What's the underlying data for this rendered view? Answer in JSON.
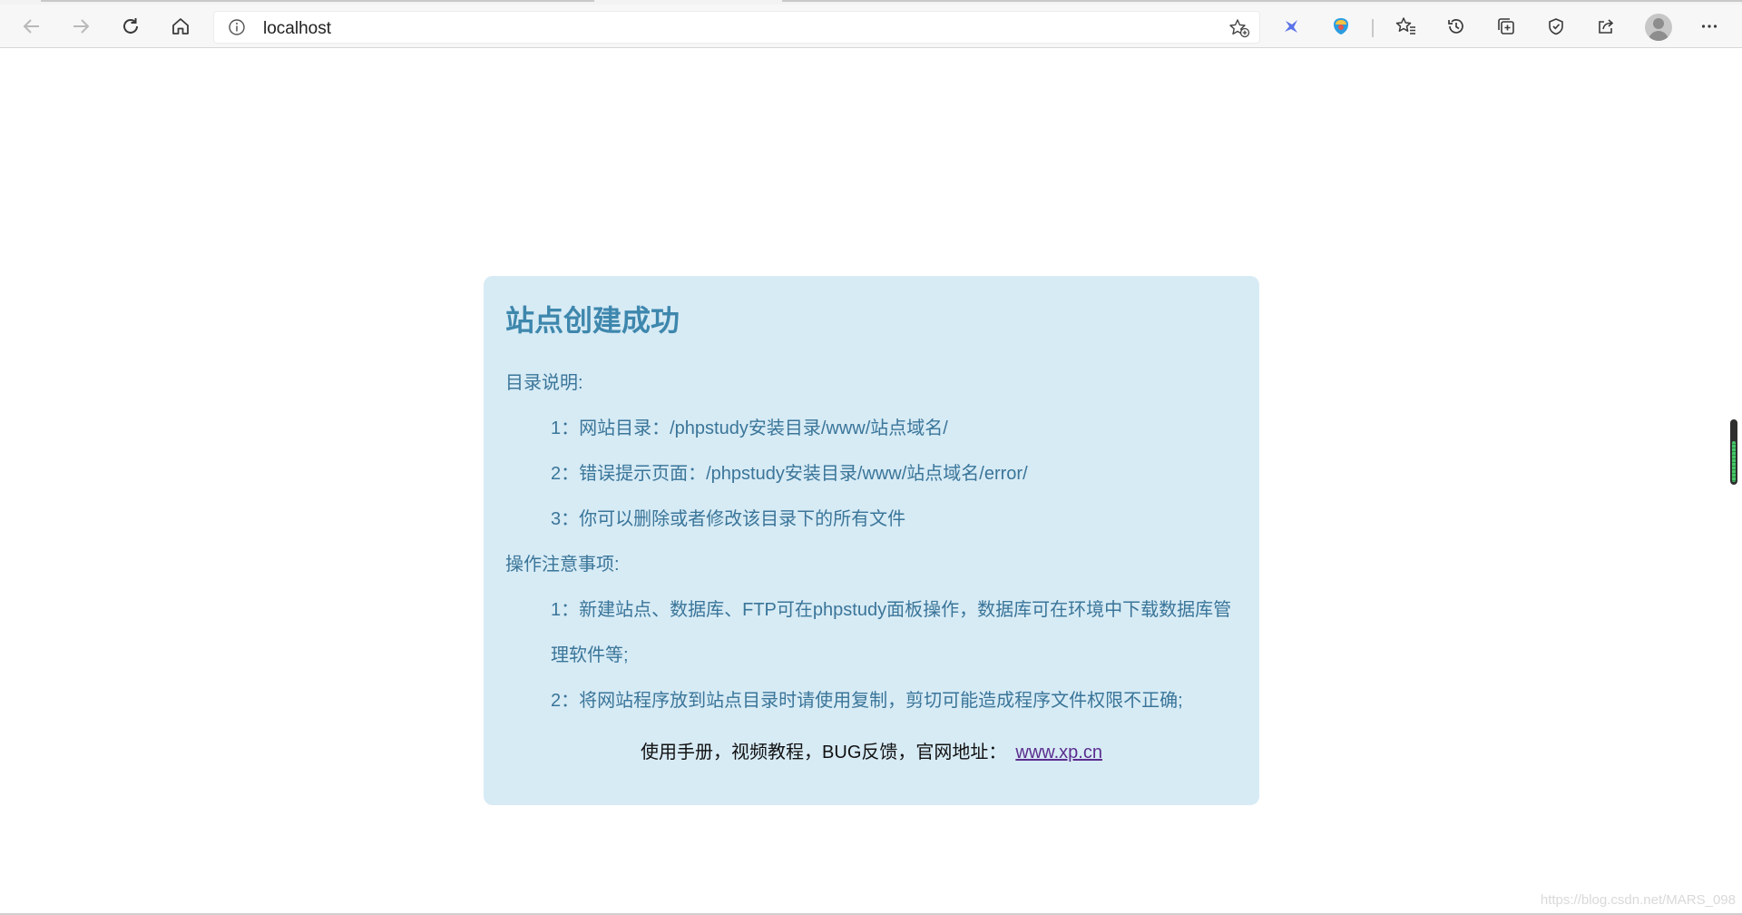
{
  "browser": {
    "address": "localhost",
    "icons": {
      "back": "back-arrow-icon",
      "forward": "forward-arrow-icon",
      "refresh": "refresh-icon",
      "home": "home-icon",
      "info": "info-icon",
      "add_favorite": "add-favorite-icon",
      "extension_1": "extension-bird-icon",
      "extension_2": "extension-shield-icon",
      "favorites": "favorites-icon",
      "history": "history-icon",
      "collections": "collections-icon",
      "performance": "performance-icon",
      "share": "share-icon",
      "profile": "profile-avatar-icon",
      "menu": "more-menu-icon"
    }
  },
  "page": {
    "title": "站点创建成功",
    "dir_heading": "目录说明:",
    "dir_items": [
      "1：网站目录：/phpstudy安装目录/www/站点域名/",
      "2：错误提示页面：/phpstudy安装目录/www/站点域名/error/",
      "3：你可以删除或者修改该目录下的所有文件"
    ],
    "ops_heading": "操作注意事项:",
    "ops_items": [
      "1：新建站点、数据库、FTP可在phpstudy面板操作，数据库可在环境中下载数据库管",
      "理软件等;",
      "2：将网站程序放到站点目录时请使用复制，剪切可能造成程序文件权限不正确;"
    ],
    "footer_text": "使用手册，视频教程，BUG反馈，官网地址：",
    "footer_link": "www.xp.cn"
  },
  "watermark": "https://blog.csdn.net/MARS_098",
  "colors": {
    "card_bg": "#d7ebf5",
    "title": "#3e87ad",
    "body_text": "#3a7599",
    "link": "#5b2d8e"
  }
}
